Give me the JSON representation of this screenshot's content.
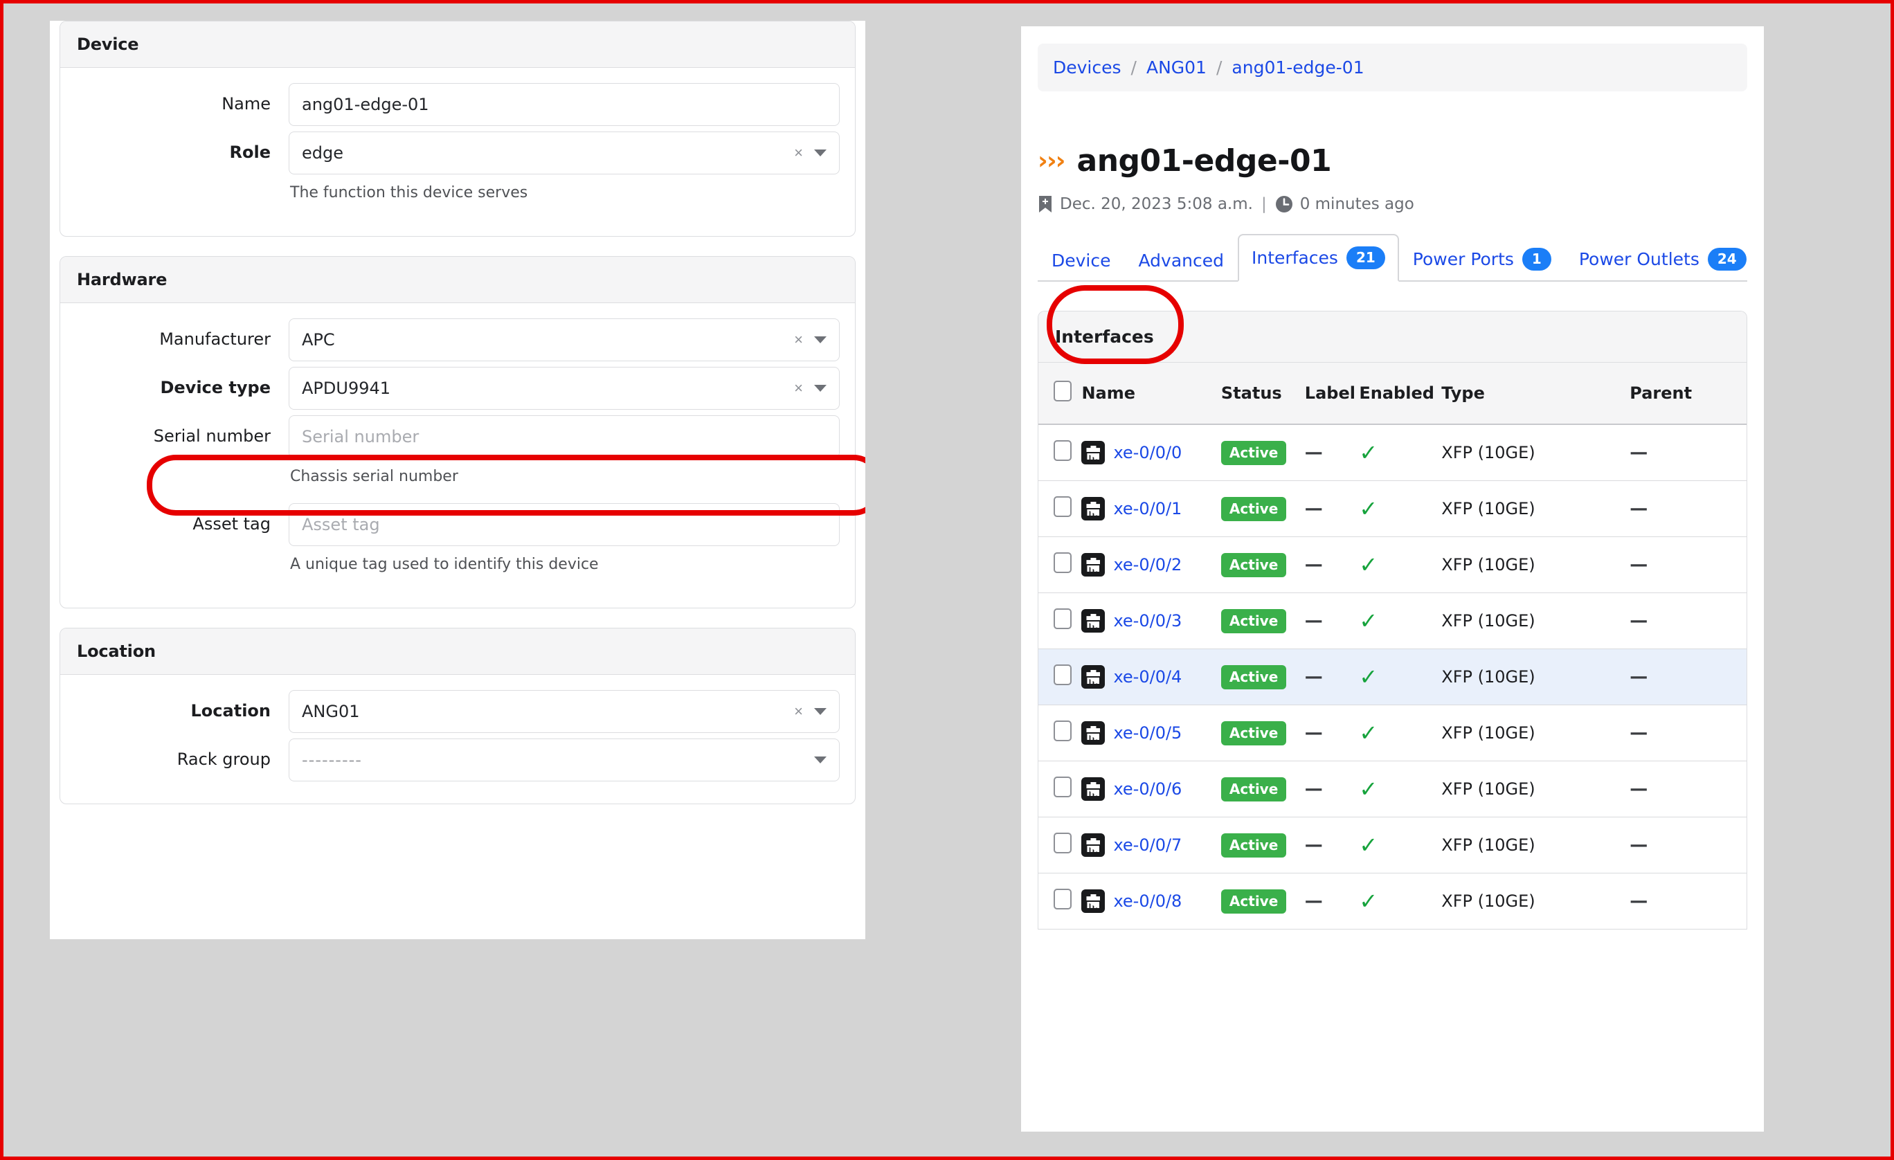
{
  "left_form": {
    "sections": [
      {
        "title": "Device",
        "fields": [
          {
            "label": "Name",
            "kind": "text",
            "value": "ang01-edge-01",
            "bold": false,
            "help": ""
          },
          {
            "label": "Role",
            "kind": "select",
            "value": "edge",
            "bold": true,
            "help": "The function this device serves"
          }
        ]
      },
      {
        "title": "Hardware",
        "fields": [
          {
            "label": "Manufacturer",
            "kind": "select",
            "value": "APC",
            "bold": false,
            "help": ""
          },
          {
            "label": "Device type",
            "kind": "select",
            "value": "APDU9941",
            "bold": true,
            "help": ""
          },
          {
            "label": "Serial number",
            "kind": "text",
            "value": "",
            "placeholder": "Serial number",
            "bold": false,
            "help": "Chassis serial number"
          },
          {
            "label": "Asset tag",
            "kind": "text",
            "value": "",
            "placeholder": "Asset tag",
            "bold": false,
            "help": "A unique tag used to identify this device"
          }
        ]
      },
      {
        "title": "Location",
        "fields": [
          {
            "label": "Location",
            "kind": "select",
            "value": "ANG01",
            "bold": true,
            "help": ""
          },
          {
            "label": "Rack group",
            "kind": "select-empty",
            "value": "---------",
            "bold": false,
            "help": ""
          }
        ]
      }
    ],
    "clear_glyph": "×"
  },
  "right_panel": {
    "breadcrumb": [
      {
        "label": "Devices"
      },
      {
        "label": "ANG01"
      },
      {
        "label": "ang01-edge-01"
      }
    ],
    "breadcrumb_separator": "/",
    "chevron_glyph": "›››",
    "page_title": "ang01-edge-01",
    "meta": {
      "created_icon": "bookmark-plus-icon",
      "created": "Dec. 20, 2023 5:08 a.m.",
      "separator": "|",
      "updated_icon": "clock-icon",
      "updated": "0 minutes ago"
    },
    "tabs": [
      {
        "label": "Device",
        "badge": "",
        "active": false
      },
      {
        "label": "Advanced",
        "badge": "",
        "active": false
      },
      {
        "label": "Interfaces",
        "badge": "21",
        "active": true
      },
      {
        "label": "Power Ports",
        "badge": "1",
        "active": false
      },
      {
        "label": "Power Outlets",
        "badge": "24",
        "active": false
      }
    ],
    "table_card_title": "Interfaces",
    "table": {
      "columns": [
        "Name",
        "Status",
        "Label",
        "Enabled",
        "Type",
        "Parent"
      ],
      "rows": [
        {
          "name": "xe-0/0/0",
          "status": "Active",
          "label": "—",
          "enabled": "✓",
          "type": "XFP (10GE)",
          "parent": "—",
          "highlighted": false
        },
        {
          "name": "xe-0/0/1",
          "status": "Active",
          "label": "—",
          "enabled": "✓",
          "type": "XFP (10GE)",
          "parent": "—",
          "highlighted": false
        },
        {
          "name": "xe-0/0/2",
          "status": "Active",
          "label": "—",
          "enabled": "✓",
          "type": "XFP (10GE)",
          "parent": "—",
          "highlighted": false
        },
        {
          "name": "xe-0/0/3",
          "status": "Active",
          "label": "—",
          "enabled": "✓",
          "type": "XFP (10GE)",
          "parent": "—",
          "highlighted": false
        },
        {
          "name": "xe-0/0/4",
          "status": "Active",
          "label": "—",
          "enabled": "✓",
          "type": "XFP (10GE)",
          "parent": "—",
          "highlighted": true
        },
        {
          "name": "xe-0/0/5",
          "status": "Active",
          "label": "—",
          "enabled": "✓",
          "type": "XFP (10GE)",
          "parent": "—",
          "highlighted": false
        },
        {
          "name": "xe-0/0/6",
          "status": "Active",
          "label": "—",
          "enabled": "✓",
          "type": "XFP (10GE)",
          "parent": "—",
          "highlighted": false
        },
        {
          "name": "xe-0/0/7",
          "status": "Active",
          "label": "—",
          "enabled": "✓",
          "type": "XFP (10GE)",
          "parent": "—",
          "highlighted": false
        },
        {
          "name": "xe-0/0/8",
          "status": "Active",
          "label": "—",
          "enabled": "✓",
          "type": "XFP (10GE)",
          "parent": "—",
          "highlighted": false
        }
      ]
    }
  },
  "annotations": {
    "color": "#e60000",
    "items": [
      {
        "name": "device-type-highlight"
      },
      {
        "name": "interfaces-tab-highlight"
      }
    ]
  }
}
